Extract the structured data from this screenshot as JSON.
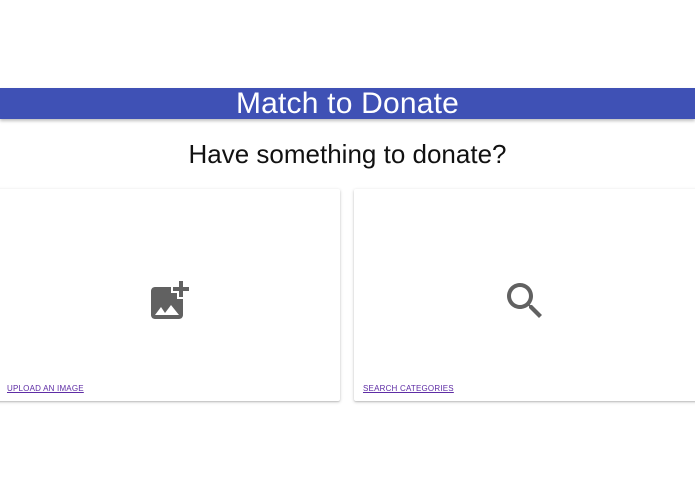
{
  "app_bar": {
    "title": "Match to Donate",
    "color": "#3f51b5"
  },
  "main": {
    "headline": "Have something to donate?",
    "cards": [
      {
        "icon": "add-photo-icon",
        "action_label": "UPLOAD AN IMAGE"
      },
      {
        "icon": "search-icon",
        "action_label": "SEARCH CATEGORIES"
      }
    ]
  },
  "colors": {
    "icon": "#616161",
    "link": "#5e2ca5"
  }
}
